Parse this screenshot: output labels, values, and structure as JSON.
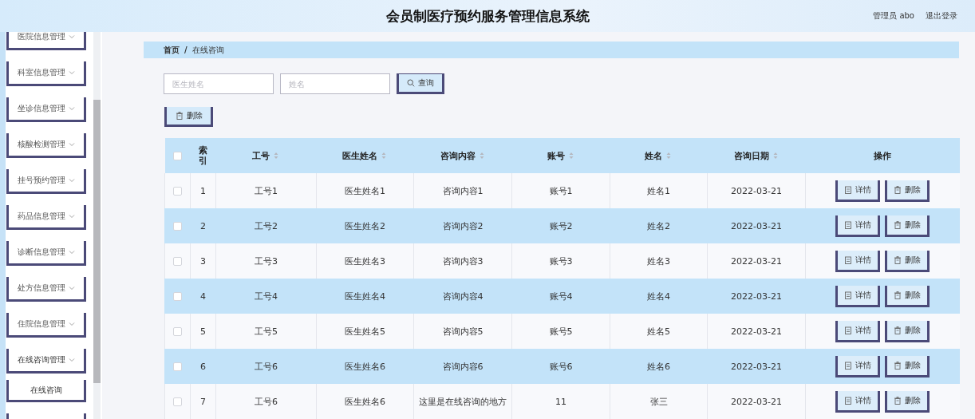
{
  "header": {
    "title": "会员制医疗预约服务管理信息系统",
    "user": "管理员 abo",
    "logout": "退出登录"
  },
  "sidebar": {
    "items": [
      {
        "label": "医院信息管理",
        "expanded": false
      },
      {
        "label": "科室信息管理",
        "expanded": false
      },
      {
        "label": "坐诊信息管理",
        "expanded": false
      },
      {
        "label": "核酸检测管理",
        "expanded": false
      },
      {
        "label": "挂号预约管理",
        "expanded": false
      },
      {
        "label": "药品信息管理",
        "expanded": false
      },
      {
        "label": "诊断信息管理",
        "expanded": false
      },
      {
        "label": "处方信息管理",
        "expanded": false
      },
      {
        "label": "住院信息管理",
        "expanded": false
      },
      {
        "label": "在线咨询管理",
        "expanded": true,
        "children": [
          {
            "label": "在线咨询",
            "selected": true
          }
        ]
      },
      {
        "expanded": false
      }
    ]
  },
  "breadcrumb": {
    "items": [
      "首页",
      "在线咨询"
    ],
    "separator": "/"
  },
  "search": {
    "fields": [
      {
        "placeholder": "医生姓名"
      },
      {
        "placeholder": "姓名"
      }
    ],
    "button": "查询"
  },
  "toolbar": {
    "delete_button": "删除"
  },
  "table": {
    "select_all": {
      "checked": false
    },
    "columns": [
      {
        "label": "索引",
        "sortable": false
      },
      {
        "label": "工号",
        "sortable": true
      },
      {
        "label": "医生姓名",
        "sortable": true
      },
      {
        "label": "咨询内容",
        "sortable": true
      },
      {
        "label": "账号",
        "sortable": true
      },
      {
        "label": "姓名",
        "sortable": true
      },
      {
        "label": "咨询日期",
        "sortable": true
      },
      {
        "label": "操作",
        "sortable": false
      }
    ],
    "rows": [
      {
        "checked": false,
        "cells": [
          "1",
          "工号1",
          "医生姓名1",
          "咨询内容1",
          "账号1",
          "姓名1",
          "2022-03-21"
        ],
        "actions": [
          {
            "kind": "detail",
            "label": "详情"
          },
          {
            "kind": "delete",
            "label": "删除"
          }
        ]
      },
      {
        "checked": false,
        "cells": [
          "2",
          "工号2",
          "医生姓名2",
          "咨询内容2",
          "账号2",
          "姓名2",
          "2022-03-21"
        ],
        "actions": [
          {
            "kind": "detail",
            "label": "详情"
          },
          {
            "kind": "delete",
            "label": "删除"
          }
        ]
      },
      {
        "checked": false,
        "cells": [
          "3",
          "工号3",
          "医生姓名3",
          "咨询内容3",
          "账号3",
          "姓名3",
          "2022-03-21"
        ],
        "actions": [
          {
            "kind": "detail",
            "label": "详情"
          },
          {
            "kind": "delete",
            "label": "删除"
          }
        ]
      },
      {
        "checked": false,
        "cells": [
          "4",
          "工号4",
          "医生姓名4",
          "咨询内容4",
          "账号4",
          "姓名4",
          "2022-03-21"
        ],
        "actions": [
          {
            "kind": "detail",
            "label": "详情"
          },
          {
            "kind": "delete",
            "label": "删除"
          }
        ]
      },
      {
        "checked": false,
        "cells": [
          "5",
          "工号5",
          "医生姓名5",
          "咨询内容5",
          "账号5",
          "姓名5",
          "2022-03-21"
        ],
        "actions": [
          {
            "kind": "detail",
            "label": "详情"
          },
          {
            "kind": "delete",
            "label": "删除"
          }
        ]
      },
      {
        "checked": false,
        "cells": [
          "6",
          "工号6",
          "医生姓名6",
          "咨询内容6",
          "账号6",
          "姓名6",
          "2022-03-21"
        ],
        "actions": [
          {
            "kind": "detail",
            "label": "详情"
          },
          {
            "kind": "delete",
            "label": "删除"
          }
        ]
      },
      {
        "checked": false,
        "cells": [
          "7",
          "工号6",
          "医生姓名6",
          "这里是在线咨询的地方",
          "11",
          "张三",
          "2022-03-21"
        ],
        "actions": [
          {
            "kind": "detail",
            "label": "详情"
          },
          {
            "kind": "delete",
            "label": "删除"
          }
        ]
      }
    ]
  }
}
